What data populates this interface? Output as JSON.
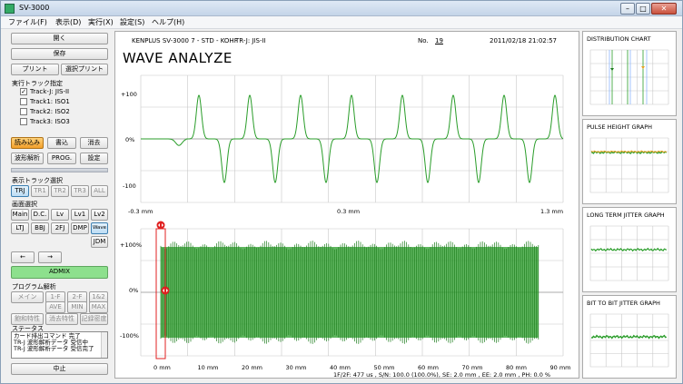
{
  "app": {
    "title": "SV-3000"
  },
  "window_buttons": {
    "minimize": "–",
    "maximize": "□",
    "close": "✕"
  },
  "menu": [
    {
      "label": "ファイル(F)"
    },
    {
      "label": "表示(D)"
    },
    {
      "label": "実行(X)"
    },
    {
      "label": "設定(S)"
    },
    {
      "label": "ヘルプ(H)"
    }
  ],
  "left": {
    "open": "開く",
    "save": "保存",
    "print": "プリント",
    "select_print": "選択プリント",
    "track_spec_label": "実行トラック指定",
    "tracks": [
      {
        "label": "Track-J:  JIS-II",
        "checked": "✓"
      },
      {
        "label": "Track1:  ISO1",
        "checked": ""
      },
      {
        "label": "Track2:  ISO2",
        "checked": ""
      },
      {
        "label": "Track3:  ISO3",
        "checked": ""
      }
    ],
    "read": "読み込み",
    "write": "書込",
    "erase": "消去",
    "wave_analysis": "波形解析",
    "prog": "PROG.",
    "settings": "設定",
    "display_track_label": "表示トラック選択",
    "display_tracks": [
      "TRJ",
      "TR1",
      "TR2",
      "TR3",
      "ALL"
    ],
    "screen_select_label": "画面選択",
    "screens_row1": [
      "Main",
      "D.C.",
      "Lv",
      "Lv1",
      "Lv2"
    ],
    "screens_row2": [
      "LTJ",
      "BBJ",
      "2FJ",
      "DMP",
      "Wave"
    ],
    "screens_row3": [
      "JDM"
    ],
    "prev": "←",
    "next": "→",
    "admix": "ADMIX",
    "program_label": "プログラム解析",
    "prog_row1": [
      "メイン",
      "1-F",
      "2-F",
      "1&2"
    ],
    "prog_row2": [
      "AVE",
      "MIN",
      "MAX"
    ],
    "prog_row3": [
      "飽和特性",
      "消去特性",
      "記録密度"
    ],
    "status_label": "ステータス",
    "status_lines": [
      "カード排出コマンド 完了",
      "TR-J 波形解析データ 受信中",
      "TR-J 波形解析データ 受信完了"
    ],
    "stop": "中止"
  },
  "header": {
    "card_info": "KENPLUS  SV-3000  7 - STD - KOHF",
    "track_info": "TR-J: JIS-II",
    "no_label": "No.",
    "no_value": "19",
    "datetime": "2011/02/18  21:02:57",
    "title": "WAVE ANALYZE"
  },
  "upper_graph": {
    "y_ticks": [
      "+100",
      "0%",
      "-100"
    ],
    "x_ticks": [
      "-0.3 mm",
      "0.3 mm",
      "1.3 mm"
    ],
    "color": "#2a9d2a"
  },
  "lower_graph": {
    "y_ticks": [
      "+100%",
      "0%",
      "-100%"
    ],
    "x_ticks": [
      "0 mm",
      "10 mm",
      "20 mm",
      "30 mm",
      "40 mm",
      "50 mm",
      "60 mm",
      "70 mm",
      "80 mm",
      "90 mm"
    ],
    "color": "#2a9d2a",
    "marker_color": "#e02020"
  },
  "footer": {
    "summary": "1F/2F: 477 us , S/N: 100.0 (100.0%), SE: 2.0 mm , EE: 2.0 mm , PH: 0.0 %"
  },
  "right": {
    "panels": [
      {
        "title": "DISTRIBUTION CHART"
      },
      {
        "title": "PULSE HEIGHT GRAPH"
      },
      {
        "title": "LONG TERM JITTER GRAPH"
      },
      {
        "title": "BIT TO BIT JITTER GRAPH"
      }
    ]
  }
}
